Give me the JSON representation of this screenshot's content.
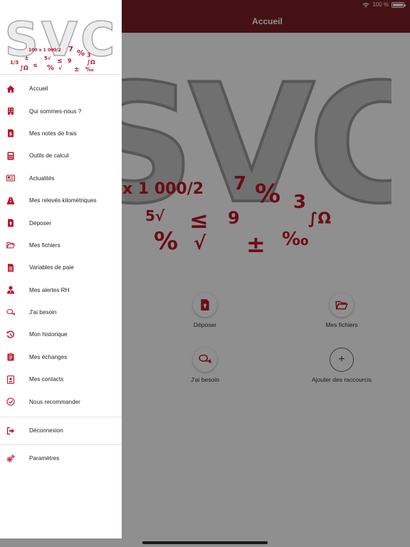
{
  "status": {
    "battery_text": "100 %"
  },
  "header": {
    "title": "Accueil"
  },
  "brand": {
    "logo_text": "SVC",
    "accent_color": "#c0142b",
    "header_color": "#7b1f27"
  },
  "shortcuts": [
    {
      "label": "Déposer",
      "icon": "file-upload-icon"
    },
    {
      "label": "Mes fichiers",
      "icon": "folder-open-icon"
    },
    {
      "label": "J'ai besoin",
      "icon": "chat-bubbles-icon"
    },
    {
      "label": "Ajouter des raccourcis",
      "icon": "plus-icon"
    }
  ],
  "menu": {
    "items": [
      {
        "label": "Accueil",
        "icon": "home-icon"
      },
      {
        "label": "Qui sommes-nous ?",
        "icon": "building-icon"
      },
      {
        "label": "Mes notes de frais",
        "icon": "receipt-icon"
      },
      {
        "label": "Outils de calcul",
        "icon": "calculator-icon"
      },
      {
        "label": "Actualités",
        "icon": "newspaper-icon"
      },
      {
        "label": "Mes relevés kilométriques",
        "icon": "road-icon"
      },
      {
        "label": "Déposer",
        "icon": "file-upload-icon"
      },
      {
        "label": "Mes fichiers",
        "icon": "folder-open-icon"
      },
      {
        "label": "Variables de paie",
        "icon": "file-text-icon"
      },
      {
        "label": "Mes alertes RH",
        "icon": "user-tie-icon"
      },
      {
        "label": "J'ai besoin",
        "icon": "chat-bubbles-icon"
      },
      {
        "label": "Mon historique",
        "icon": "history-icon"
      },
      {
        "label": "Mes échanges",
        "icon": "clipboard-icon"
      },
      {
        "label": "Mes contacts",
        "icon": "contact-card-icon"
      },
      {
        "label": "Nous recommander",
        "icon": "check-circle-icon"
      }
    ],
    "logout": {
      "label": "Déconnexion",
      "icon": "sign-out-icon"
    },
    "settings": {
      "label": "Paramètres",
      "icon": "cogs-icon"
    }
  }
}
